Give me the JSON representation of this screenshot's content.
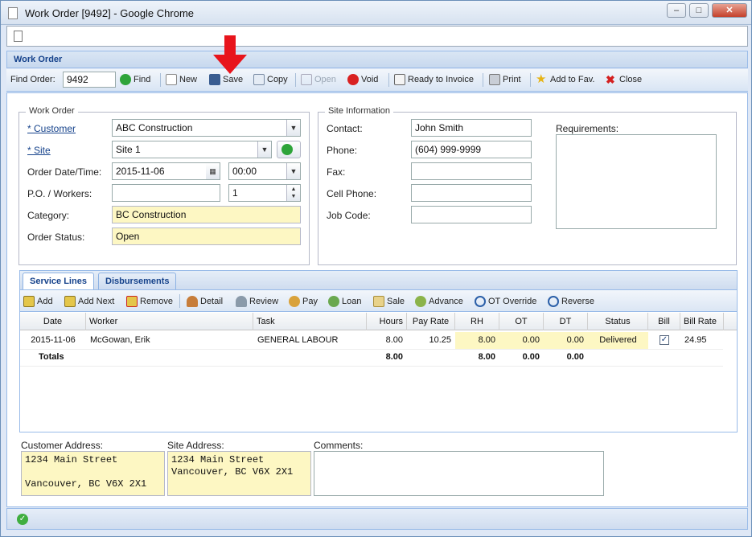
{
  "window": {
    "title": "Work Order [9492] - Google Chrome"
  },
  "panel": {
    "title": "Work Order"
  },
  "toolbar": {
    "find_label": "Find Order:",
    "find_value": "9492",
    "find": "Find",
    "new": "New",
    "save": "Save",
    "copy": "Copy",
    "open": "Open",
    "void": "Void",
    "ready_to_invoice": "Ready to Invoice",
    "print": "Print",
    "add_to_fav": "Add to Fav.",
    "close": "Close"
  },
  "work_order": {
    "legend": "Work Order",
    "customer_label": "* Customer",
    "customer_value": "ABC Construction",
    "site_label": "* Site",
    "site_value": "Site 1",
    "order_date_label": "Order Date/Time:",
    "order_date_value": "2015-11-06",
    "order_time_value": "00:00",
    "po_workers_label": "P.O. / Workers:",
    "po_value": "",
    "workers_value": "1",
    "category_label": "Category:",
    "category_value": "BC Construction",
    "status_label": "Order Status:",
    "status_value": "Open"
  },
  "site_info": {
    "legend": "Site Information",
    "contact_label": "Contact:",
    "contact_value": "John Smith",
    "phone_label": "Phone:",
    "phone_value": "(604) 999-9999",
    "fax_label": "Fax:",
    "fax_value": "",
    "cell_label": "Cell Phone:",
    "cell_value": "",
    "job_code_label": "Job Code:",
    "job_code_value": "",
    "requirements_label": "Requirements:"
  },
  "tabs": {
    "service_lines": "Service Lines",
    "disbursements": "Disbursements"
  },
  "grid_toolbar": {
    "add": "Add",
    "add_next": "Add Next",
    "remove": "Remove",
    "detail": "Detail",
    "review": "Review",
    "pay": "Pay",
    "loan": "Loan",
    "sale": "Sale",
    "advance": "Advance",
    "ot_override": "OT Override",
    "reverse": "Reverse"
  },
  "grid": {
    "columns": [
      "Date",
      "Worker",
      "Task",
      "Hours",
      "Pay Rate",
      "RH",
      "OT",
      "DT",
      "Status",
      "Bill",
      "Bill Rate"
    ],
    "row": {
      "date": "2015-11-06",
      "worker": "McGowan, Erik",
      "task": "GENERAL LABOUR",
      "hours": "8.00",
      "pay_rate": "10.25",
      "rh": "8.00",
      "ot": "0.00",
      "dt": "0.00",
      "status": "Delivered",
      "bill_rate": "24.95"
    },
    "totals": {
      "label": "Totals",
      "hours": "8.00",
      "rh": "8.00",
      "ot": "0.00",
      "dt": "0.00"
    }
  },
  "addresses": {
    "customer_label": "Customer Address:",
    "customer_value": "1234 Main Street\n\nVancouver, BC V6X 2X1",
    "site_label": "Site Address:",
    "site_value": "1234 Main Street\nVancouver, BC V6X 2X1",
    "comments_label": "Comments:"
  },
  "colors": {
    "accent": "#15428b",
    "yellow_field": "#fdf7c3",
    "annotation_arrow": "#e8141c"
  }
}
